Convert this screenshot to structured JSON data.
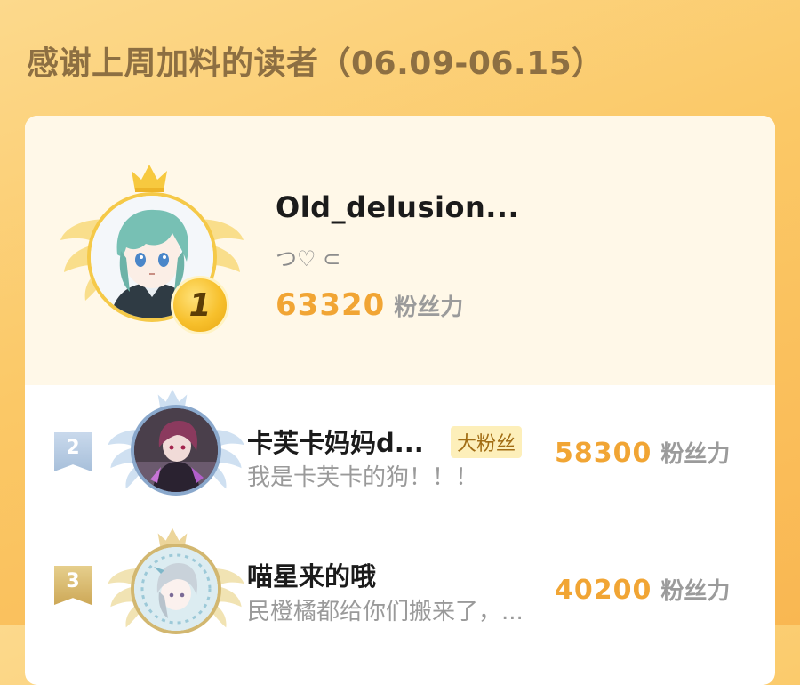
{
  "header": {
    "title": "感谢上周加料的读者（06.09-06.15）"
  },
  "colors": {
    "accent": "#f1a534",
    "gold": "#f5c948",
    "silver": "#a7bfda",
    "bronze": "#cda857"
  },
  "champion": {
    "rank": "1",
    "name": "Old_delusion...",
    "bio": "つ♡ ⊂",
    "score": "63320",
    "score_unit": "粉丝力",
    "avatar_icon": "anime-avatar-teal-hair"
  },
  "list": [
    {
      "rank": "2",
      "name": "卡芙卡妈妈d...",
      "tag": "大粉丝",
      "bio": "我是卡芙卡的狗！！！",
      "score": "58300",
      "score_unit": "粉丝力",
      "avatar_icon": "anime-avatar-dark"
    },
    {
      "rank": "3",
      "name": "喵星来的哦",
      "bio": "民橙橘都给你们搬来了，...",
      "score": "40200",
      "score_unit": "粉丝力",
      "avatar_icon": "anime-avatar-silver-hair"
    }
  ]
}
